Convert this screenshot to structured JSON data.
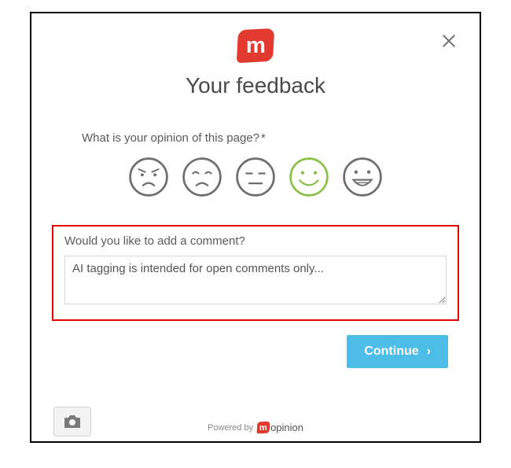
{
  "logo_letter": "m",
  "title": "Your feedback",
  "question": {
    "label": "What is your opinion of this page?",
    "required_mark": "*"
  },
  "faces": {
    "selected_index": 3,
    "items": [
      {
        "name": "angry"
      },
      {
        "name": "sad"
      },
      {
        "name": "neutral"
      },
      {
        "name": "happy"
      },
      {
        "name": "very-happy"
      }
    ]
  },
  "comment": {
    "label": "Would you like to add a comment?",
    "value": "AI tagging is intended for open comments only..."
  },
  "continue_label": "Continue",
  "footer": {
    "powered_by": "Powered by",
    "brand_letter": "m",
    "brand_rest": "opinion"
  },
  "colors": {
    "accent_red": "#e23a2e",
    "highlight_red": "#e40000",
    "selected_green": "#8ac249",
    "button_blue": "#4cbde7"
  }
}
